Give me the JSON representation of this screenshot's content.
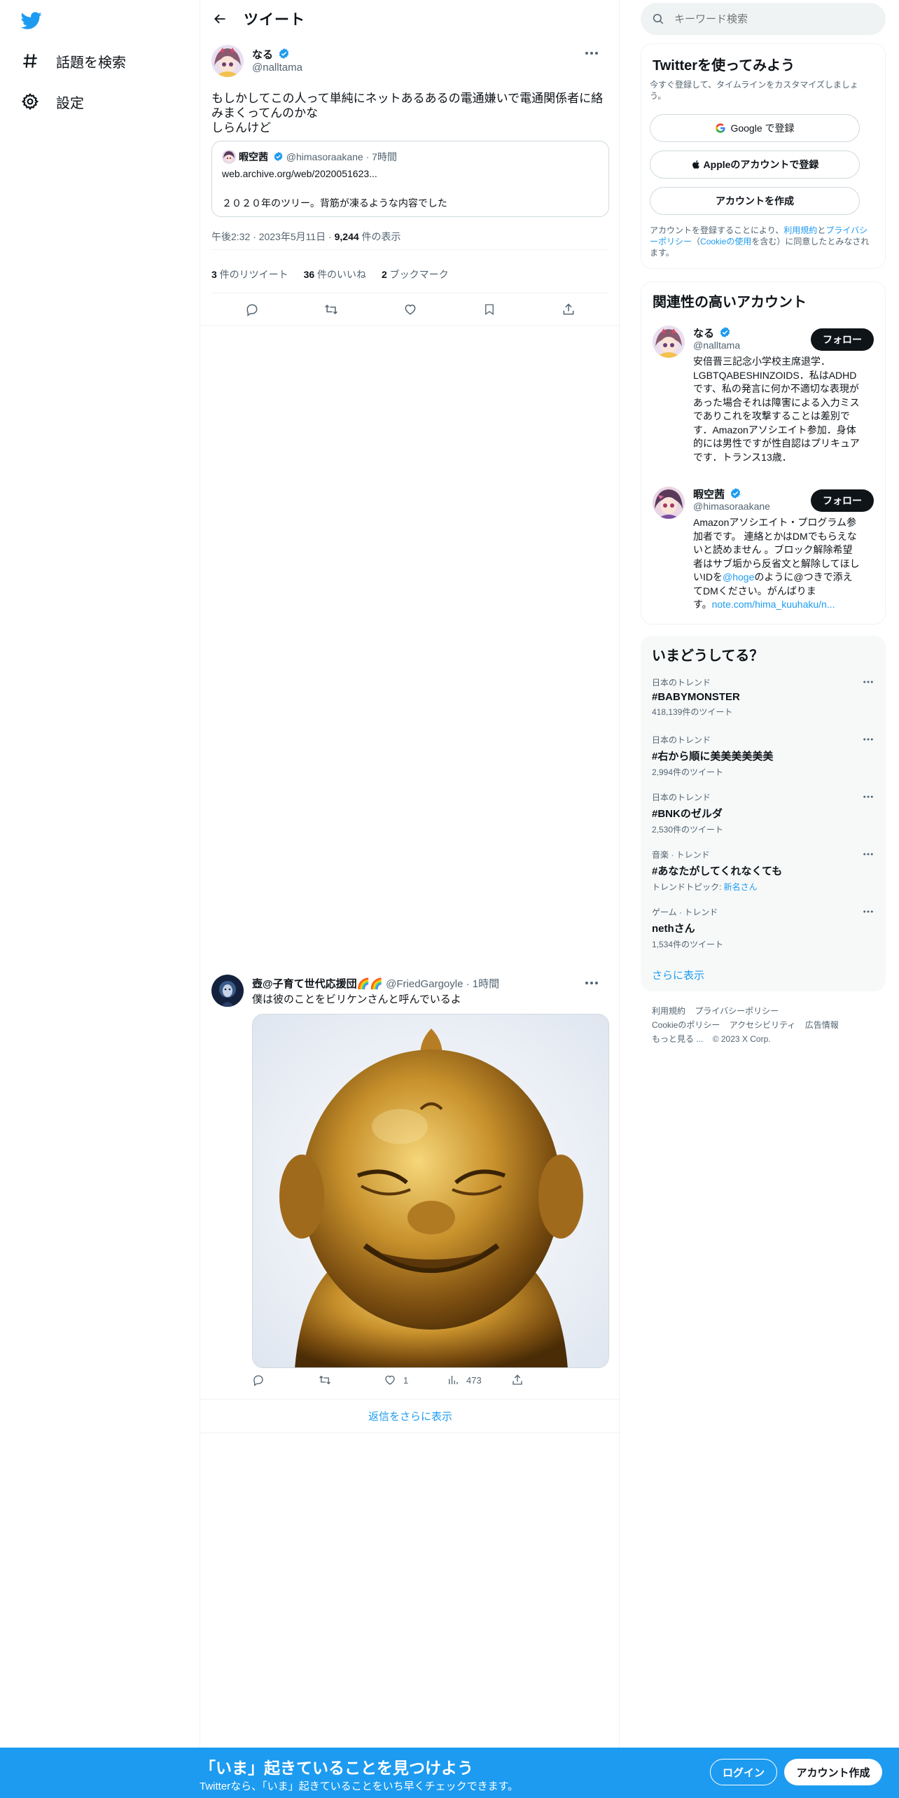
{
  "nav": {
    "explore_label": "話題を検索",
    "settings_label": "設定"
  },
  "header": {
    "title": "ツイート"
  },
  "main_tweet": {
    "author_name": "なる",
    "author_handle": "@nalltama",
    "text_line1": "もしかしてこの人って単純にネットあるあるの電通嫌いで電通関係者に絡",
    "text_line2": "みまくってんのかな",
    "text_line3": "しらんけど",
    "quote": {
      "author_name": "暇空茜",
      "author_handle": "@himasoraakane",
      "time": "· 7時間",
      "link_text": "web.archive.org/web/2020051623...",
      "body": "２０２０年のツリー。背筋が凍るような内容でした"
    },
    "timestamp": "午後2:32 · 2023年5月11日 · ",
    "views_count": "9,244",
    "views_label": " 件の表示",
    "retweets_count": "3",
    "retweets_label": " 件のリツイート",
    "likes_count": "36",
    "likes_label": " 件のいいね",
    "bookmarks_count": "2",
    "bookmarks_label": " ブックマーク"
  },
  "reply": {
    "author_name": "壺@子育て世代応援団🌈🌈",
    "author_handle": "@FriedGargoyle",
    "time": "· 1時間",
    "text": "僕は彼のことをビリケンさんと呼んでいるよ",
    "likes": "1",
    "views": "473"
  },
  "show_more_replies": "返信をさらに表示",
  "search": {
    "placeholder": "キーワード検索"
  },
  "signup_card": {
    "title": "Twitterを使ってみよう",
    "subtitle": "今すぐ登録して、タイムラインをカスタマイズしましょう。",
    "google_btn": "Google で登録",
    "apple_btn": "Appleのアカウントで登録",
    "create_btn": "アカウントを作成",
    "terms_1": "アカウントを登録することにより、",
    "terms_link1": "利用規約",
    "terms_2": "と",
    "terms_link2": "プライバシーポリシー",
    "terms_3": "（",
    "terms_link3": "Cookieの使用",
    "terms_4": "を含む）に同意したとみなされます。"
  },
  "relevant": {
    "title": "関連性の高いアカウント",
    "follow_label": "フォロー",
    "accounts": [
      {
        "name": "なる",
        "handle": "@nalltama",
        "bio_lines": [
          "安倍晋三記念小学校主席退学．",
          "LGBTQABESHINZOIDS．私はADHD",
          "です、私の発言に何か不適切な表現が",
          "あった場合それは障害による入力ミス",
          "でありこれを攻撃することは差別で",
          "す．Amazonアソシエイト参加．身体",
          "的には男性ですが性自認はプリキュア",
          "です．トランス13歳．"
        ]
      },
      {
        "name": "暇空茜",
        "handle": "@himasoraakane",
        "bio_lines": [
          "Amazonアソシエイト・プログラム参",
          "加者です。 連絡とかはDMでもらえな",
          "いと読めません 。ブロック解除希望",
          "者はサブ垢から反省文と解除してほし"
        ],
        "bio_l5a": "いIDを",
        "bio_l5link": "@hoge",
        "bio_l5b": "のように@つきで添え",
        "bio_l6": "てDMください。がんばりま",
        "bio_l7a": "す。",
        "bio_l7link": "note.com/hima_kuuhaku/n..."
      }
    ]
  },
  "trends": {
    "title": "いまどうしてる？",
    "items": [
      {
        "category": "日本のトレンド",
        "name": "#BABYMONSTER",
        "count": "418,139件のツイート"
      },
      {
        "category": "日本のトレンド",
        "name": "#右から順に美美美美美美",
        "count": "2,994件のツイート"
      },
      {
        "category": "日本のトレンド",
        "name": "#BNKのゼルダ",
        "count": "2,530件のツイート"
      },
      {
        "category": "音楽 · トレンド",
        "name": "#あなたがしてくれなくても",
        "count_prefix": "トレンドトピック: ",
        "count_link": "新名さん"
      },
      {
        "category": "ゲーム · トレンド",
        "name": "nethさん",
        "count": "1,534件のツイート"
      }
    ],
    "show_more": "さらに表示"
  },
  "footer": {
    "terms": "利用規約",
    "privacy": "プライバシーポリシー",
    "cookie": "Cookieのポリシー",
    "accessibility": "アクセシビリティ",
    "ads": "広告情報",
    "more": "もっと見る ...",
    "copyright": "© 2023 X Corp."
  },
  "banner": {
    "title": "「いま」起きていることを見つけよう",
    "subtitle": "Twitterなら、「いま」起きていることをいち早くチェックできます。",
    "login": "ログイン",
    "signup": "アカウント作成"
  },
  "colors": {
    "accent": "#1d9bf0",
    "text": "#0f1419",
    "muted": "#536471"
  }
}
